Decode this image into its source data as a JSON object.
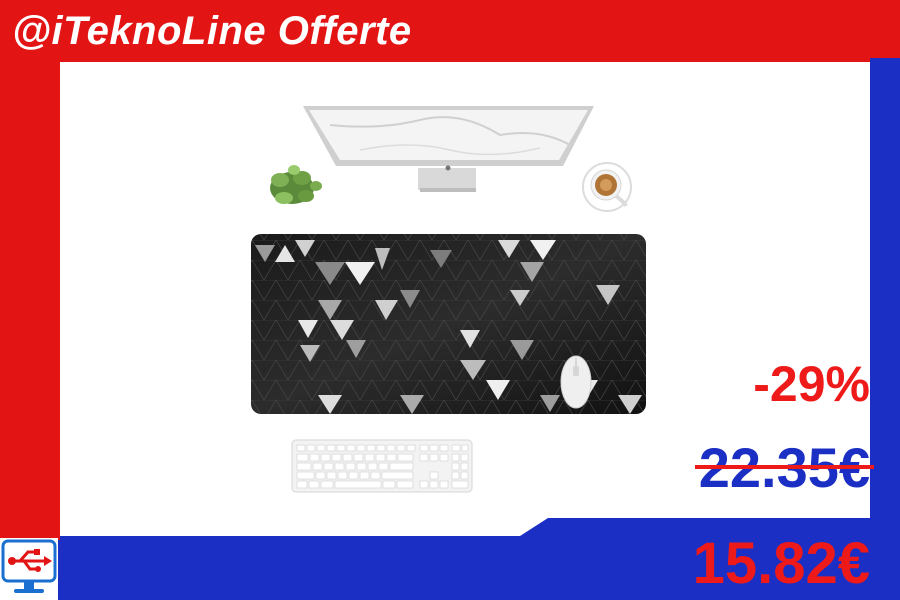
{
  "brand": {
    "title": "@iTeknoLine Offerte",
    "logo_icon": "usb-monitor-icon"
  },
  "product": {
    "image_icon": "desk-mousepad-product-image",
    "mousepad_pattern": "black-white-geometric-triangles"
  },
  "pricing": {
    "discount": "-29%",
    "old_price": "22.35€",
    "new_price": "15.82€"
  },
  "colors": {
    "red": "#e31414",
    "blue": "#1b2fc4",
    "white": "#ffffff"
  }
}
